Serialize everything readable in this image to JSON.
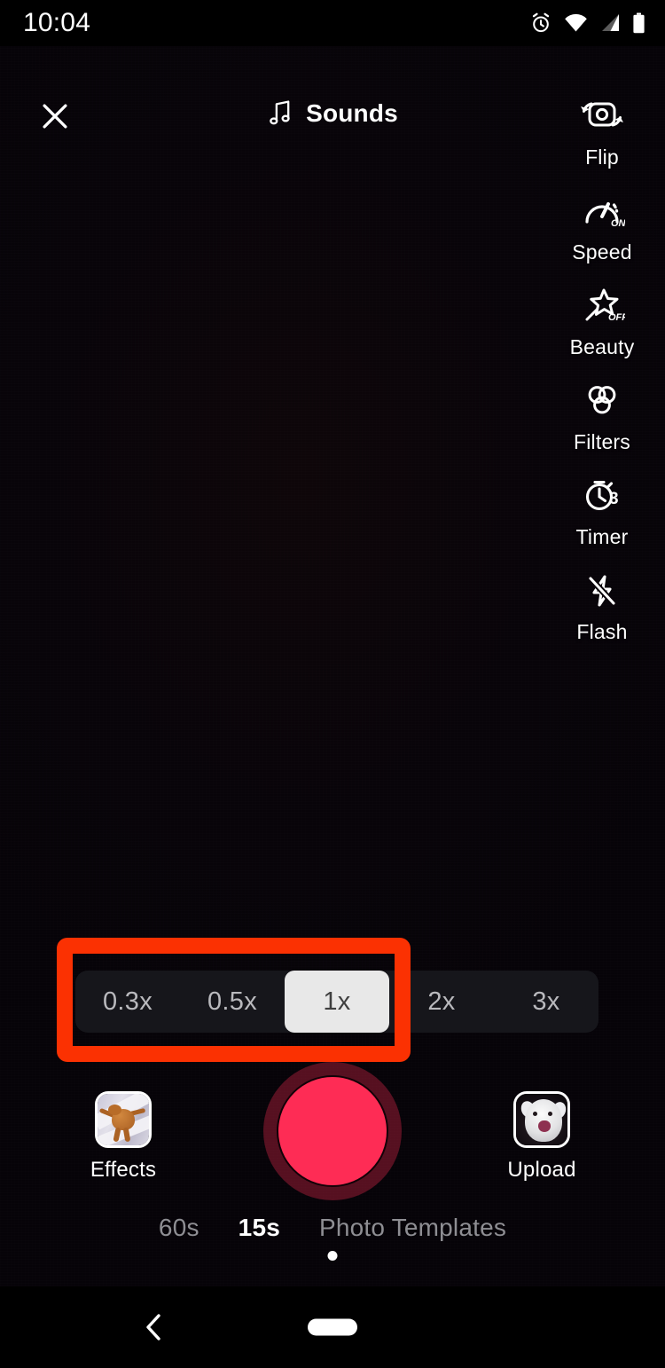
{
  "status_bar": {
    "time": "10:04",
    "icons": [
      "alarm-icon",
      "wifi-icon",
      "cellular-signal-icon",
      "battery-icon"
    ]
  },
  "top_bar": {
    "close_icon": "close-icon",
    "sounds_label": "Sounds",
    "sounds_icon": "music-note-icon"
  },
  "tool_rail": [
    {
      "label": "Flip",
      "icon": "camera-flip-icon",
      "state": ""
    },
    {
      "label": "Speed",
      "icon": "speedometer-icon",
      "state": "ON"
    },
    {
      "label": "Beauty",
      "icon": "magic-wand-icon",
      "state": "OFF"
    },
    {
      "label": "Filters",
      "icon": "filters-icon",
      "state": ""
    },
    {
      "label": "Timer",
      "icon": "stopwatch-icon",
      "state": "3"
    },
    {
      "label": "Flash",
      "icon": "flash-off-icon",
      "state": ""
    }
  ],
  "speed_selector": {
    "options": [
      "0.3x",
      "0.5x",
      "1x",
      "2x",
      "3x"
    ],
    "selected": "1x",
    "selected_index": 2
  },
  "annotation": {
    "color": "#fb3102",
    "target": "speed-selector"
  },
  "capture_row": {
    "effects_label": "Effects",
    "upload_label": "Upload",
    "record_label": "record-button",
    "record_color": "#fe2c55"
  },
  "modes": {
    "items": [
      "60s",
      "15s",
      "Photo Templates"
    ],
    "active": "15s",
    "active_index": 1
  },
  "nav_bar": {
    "back_icon": "back-chevron-icon",
    "home_icon": "home-pill-icon"
  }
}
